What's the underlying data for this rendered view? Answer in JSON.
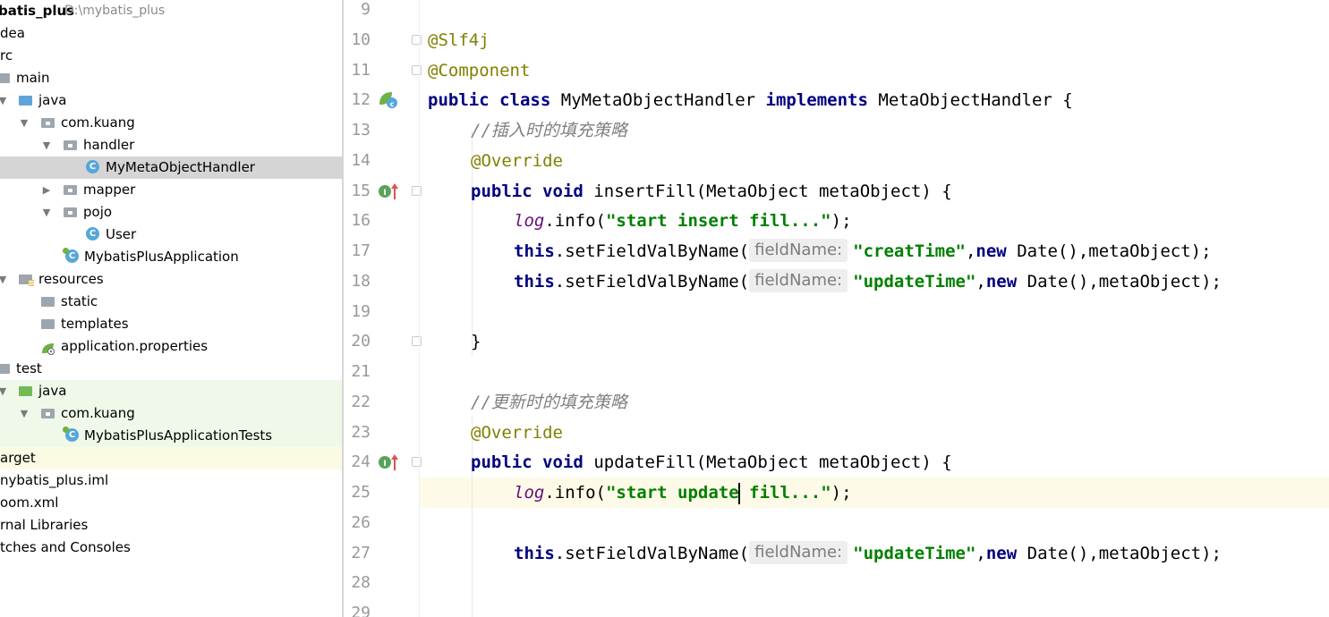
{
  "project": {
    "name": "batis_plus",
    "path": "D:\\mybatis_plus",
    "items": [
      {
        "label": "dea"
      },
      {
        "label": "rc"
      },
      {
        "label": "main"
      },
      {
        "label": "java"
      },
      {
        "label": "com.kuang"
      },
      {
        "label": "handler"
      },
      {
        "label": "MyMetaObjectHandler"
      },
      {
        "label": "mapper"
      },
      {
        "label": "pojo"
      },
      {
        "label": "User"
      },
      {
        "label": "MybatisPlusApplication"
      },
      {
        "label": "resources"
      },
      {
        "label": "static"
      },
      {
        "label": "templates"
      },
      {
        "label": "application.properties"
      },
      {
        "label": "test"
      },
      {
        "label": "java"
      },
      {
        "label": "com.kuang"
      },
      {
        "label": "MybatisPlusApplicationTests"
      },
      {
        "label": "arget"
      },
      {
        "label": "nybatis_plus.iml"
      },
      {
        "label": "oom.xml"
      },
      {
        "label": "rnal Libraries"
      },
      {
        "label": "tches and Consoles"
      }
    ]
  },
  "icons": {
    "class_letter": "C",
    "arrow_expanded": "▼",
    "arrow_collapsed": "▶"
  },
  "colors": {
    "keyword": "#000080",
    "annotation": "#808000",
    "string": "#008000",
    "comment": "#808080",
    "static_field": "#660e7a",
    "current_line": "#fdfae8",
    "selected_row": "#d5d5d5",
    "test_rows": "#eff8e9",
    "excluded_row": "#fbfbe3"
  },
  "editor": {
    "line_numbers": [
      "9",
      "10",
      "11",
      "12",
      "13",
      "14",
      "15",
      "16",
      "17",
      "18",
      "19",
      "20",
      "21",
      "22",
      "23",
      "24",
      "25",
      "26",
      "27",
      "28",
      "29"
    ],
    "current_line": "25",
    "code": {
      "l10": {
        "ann": "@Slf4j"
      },
      "l11": {
        "ann": "@Component"
      },
      "l12": {
        "kw1": "public",
        "kw2": "class",
        "name": "MyMetaObjectHandler",
        "kw3": "implements",
        "iface": "MetaObjectHandler {"
      },
      "l13": {
        "comment": "//插入时的填充策略"
      },
      "l14": {
        "ann": "@Override"
      },
      "l15": {
        "kw1": "public",
        "kw2": "void",
        "rest": "insertFill(MetaObject metaObject) {"
      },
      "l16": {
        "log": "log",
        "mid": ".info(",
        "str": "\"start insert fill...\"",
        "end": ");"
      },
      "l17": {
        "kw": "this",
        "mid": ".setFieldValByName(",
        "hint": "fieldName:",
        "str": "\"creatTime\"",
        "sep": ",",
        "kw2": "new",
        "end": " Date(),metaObject);"
      },
      "l18": {
        "kw": "this",
        "mid": ".setFieldValByName(",
        "hint": "fieldName:",
        "str": "\"updateTime\"",
        "sep": ",",
        "kw2": "new",
        "end": " Date(),metaObject);"
      },
      "l20": {
        "brace": "}"
      },
      "l22": {
        "comment": "//更新时的填充策略"
      },
      "l23": {
        "ann": "@Override"
      },
      "l24": {
        "kw1": "public",
        "kw2": "void",
        "rest": "updateFill(MetaObject metaObject) {"
      },
      "l25": {
        "log": "log",
        "mid": ".info(",
        "str1": "\"start update",
        "str2": " fill...\"",
        "end": ");"
      },
      "l27": {
        "kw": "this",
        "mid": ".setFieldValByName(",
        "hint": "fieldName:",
        "str": "\"updateTime\"",
        "sep": ",",
        "kw2": "new",
        "end": " Date(),metaObject);"
      }
    }
  }
}
